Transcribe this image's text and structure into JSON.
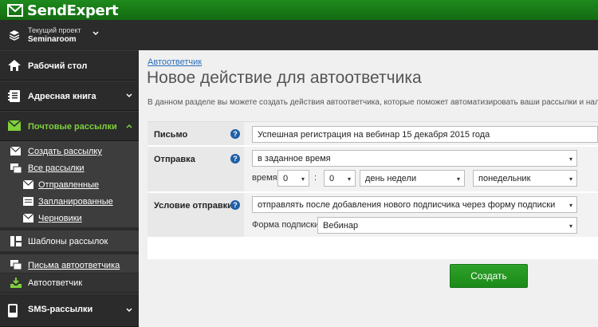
{
  "app": {
    "logo_text": "SendExpert"
  },
  "project": {
    "caption": "Текущий проект",
    "name": "Seminaroom"
  },
  "sidebar": {
    "desktop": "Рабочий стол",
    "address_book": "Адресная книга",
    "mailings": "Почтовые рассылки",
    "mailings_sub": {
      "create": "Создать рассылку",
      "all": "Все рассылки",
      "sent": "Отправленные",
      "scheduled": "Запланированные",
      "drafts": "Черновики"
    },
    "templates": "Шаблоны рассылок",
    "autoresponder_letters": "Письма автоответчика",
    "autoresponder": "Автоответчик",
    "sms": "SMS-рассылки"
  },
  "main": {
    "breadcrumb": "Автоответчик",
    "title": "Новое действие для автоответчика",
    "description": "В данном разделе вы можете создать действия автоответчика, которые поможет автоматизировать ваши рассылки и налад"
  },
  "form": {
    "letter_label": "Письмо",
    "letter_value": "Успешная регистрация на вебинар 15 декабря 2015 года",
    "send_label": "Отправка",
    "send_mode": "в заданное время",
    "time_label": "время",
    "hour": "0",
    "colon": ":",
    "minute": "0",
    "period": "день недели",
    "day": "понедельник",
    "condition_label": "Условие отправки",
    "condition_value": "отправлять после добавления нового подписчика через форму подписки",
    "form_label": "Форма подписки",
    "form_value": "Вебинар",
    "help_glyph": "?",
    "arrow_glyph": "▾"
  },
  "actions": {
    "create_label": "Создать"
  },
  "colors": {
    "brand_green": "#1c8a19",
    "sidebar_bg": "#2b2b2b",
    "active_green": "#7fd13b",
    "link_blue": "#2a6ebb"
  }
}
